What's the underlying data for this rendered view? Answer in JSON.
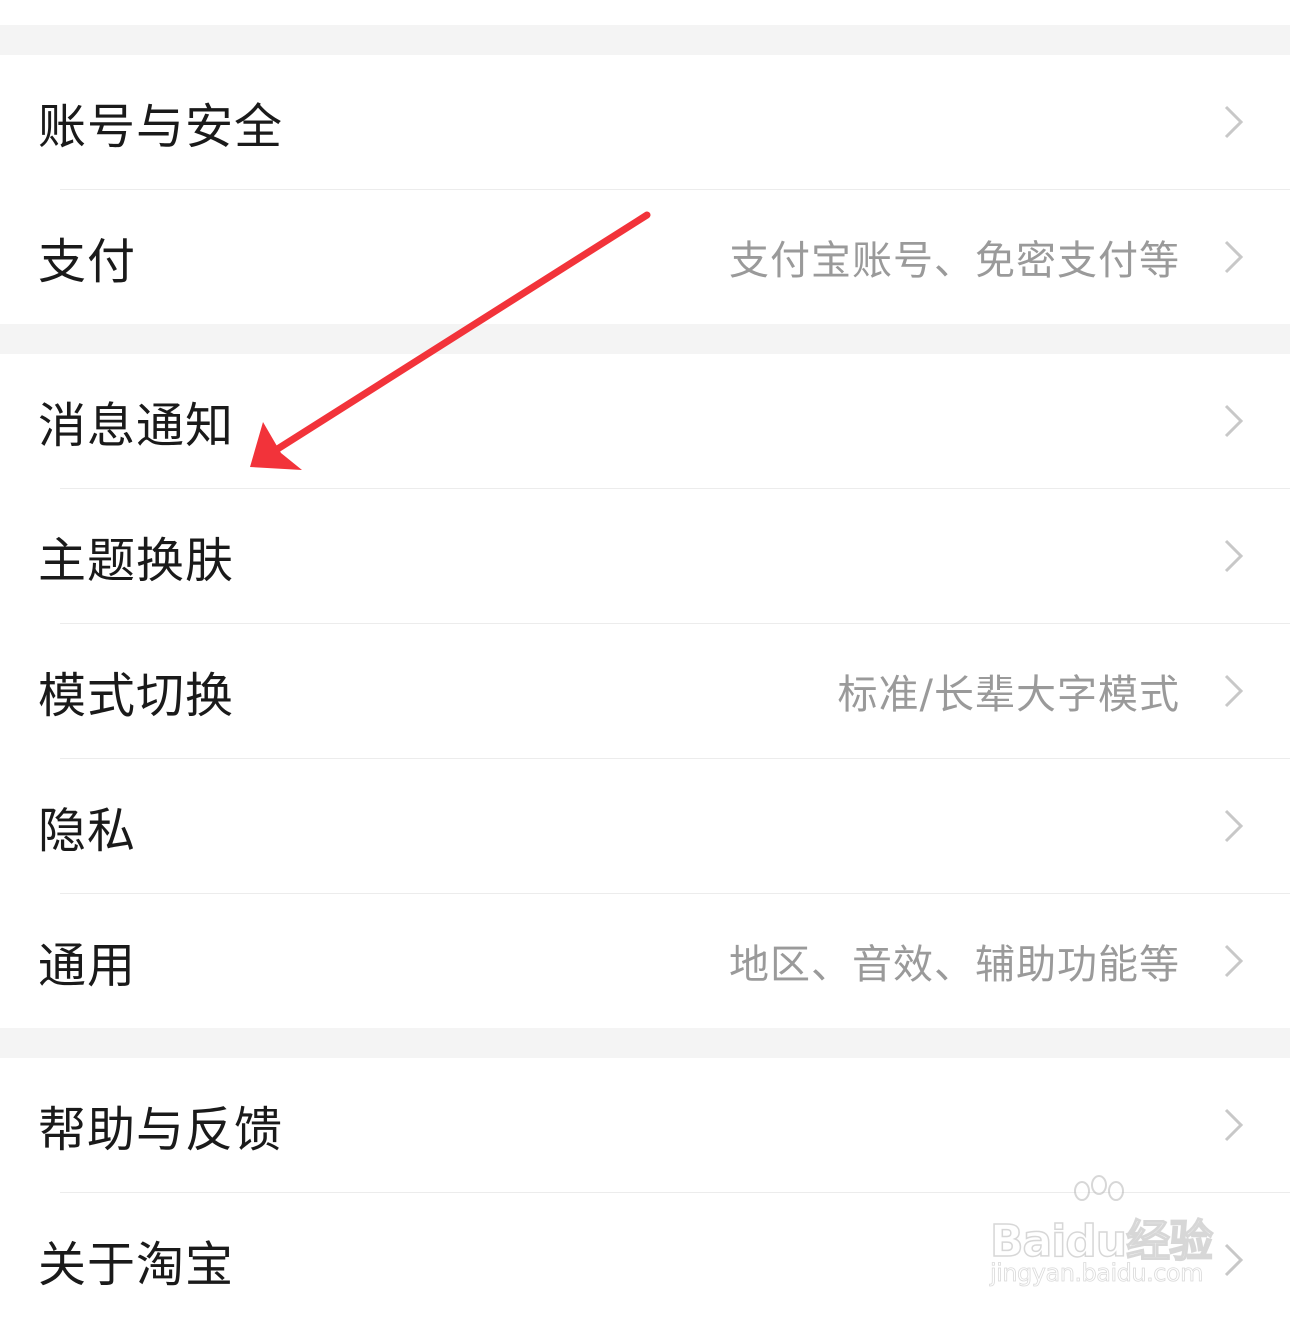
{
  "settings": {
    "group1": [
      {
        "label": "账号与安全",
        "value": ""
      },
      {
        "label": "支付",
        "value": "支付宝账号、免密支付等"
      }
    ],
    "group2": [
      {
        "label": "消息通知",
        "value": ""
      },
      {
        "label": "主题换肤",
        "value": ""
      },
      {
        "label": "模式切换",
        "value": "标准/长辈大字模式"
      },
      {
        "label": "隐私",
        "value": ""
      },
      {
        "label": "通用",
        "value": "地区、音效、辅助功能等"
      }
    ],
    "group3": [
      {
        "label": "帮助与反馈",
        "value": ""
      },
      {
        "label": "关于淘宝",
        "value": ""
      }
    ]
  },
  "icons": {
    "row_chevron": "chevron-right-icon",
    "annotation": "red-arrow-annotation"
  },
  "colors": {
    "label": "#1a1a1a",
    "secondary": "#9a9a9a",
    "chevron": "#c8c8c8",
    "separator": "#ececec",
    "group_gap": "#f4f4f4",
    "annotation_arrow": "#f2333a"
  },
  "watermark": {
    "brand": "Baidu经验",
    "url": "jingyan.baidu.com"
  }
}
